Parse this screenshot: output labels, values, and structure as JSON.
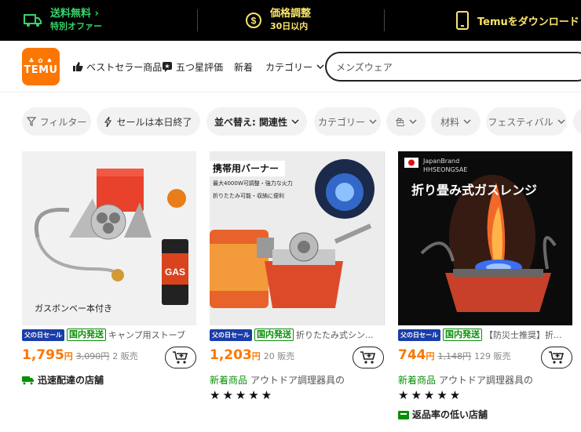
{
  "promo": {
    "shipping_title": "送料無料",
    "shipping_sub": "特別オファー",
    "price_title": "価格調整",
    "price_sub": "30日以内",
    "app_text": "Temuをダウンロード"
  },
  "header": {
    "logo_text": "TEMU",
    "nav": [
      "ベストセラー商品",
      "五つ星評価",
      "新着",
      "カテゴリー"
    ],
    "search_value": "メンズウェア"
  },
  "filters": [
    {
      "label": "フィルター"
    },
    {
      "label": "セールは本日終了"
    },
    {
      "label": "並べ替え: 関連性"
    },
    {
      "label": "カテゴリー"
    },
    {
      "label": "色"
    },
    {
      "label": "材料"
    },
    {
      "label": "フェスティバル"
    }
  ],
  "products": [
    {
      "image_caption": "ガスボンベー本付き",
      "promo_tag": "父の日セール",
      "domestic_tag": "国内発送",
      "title": "キャンプ用ストーブ",
      "price": "1,795",
      "yen": "円",
      "original_price": "3,090円",
      "sold": "2 販売",
      "store_badge": "迅速配達の店舗"
    },
    {
      "image_title": "携帯用バーナー",
      "image_sub1": "最大4000W可調整・強力な火力",
      "image_sub2": "折りたたみ可能・収納に便利",
      "promo_tag": "父の日セール",
      "domestic_tag": "国内発送",
      "title": "折りたたみ式シン...",
      "price": "1,203",
      "yen": "円",
      "sold": "20 販売",
      "new_label": "新着商品",
      "desc": "アウトドア調理器具の",
      "stars": "★★★★★"
    },
    {
      "image_brand1": "JapanBrand",
      "image_brand2": "HHSEONGSAE",
      "image_title": "折り畳み式ガスレンジ",
      "promo_tag": "父の日セール",
      "domestic_tag": "国内発送",
      "title": "【防災士推奨】折...",
      "price": "744",
      "yen": "円",
      "original_price": "1,148円",
      "sold": "129 販売",
      "new_label": "新着商品",
      "desc": "アウトドア調理器具の",
      "stars": "★★★★★",
      "store_badge": "返品率の低い店舗"
    }
  ],
  "colors": {
    "accent": "#fb7701",
    "green": "#0a8f08",
    "promo_green": "#36d36b",
    "promo_yellow": "#fbe56b",
    "tag_blue": "#1a3da8"
  }
}
